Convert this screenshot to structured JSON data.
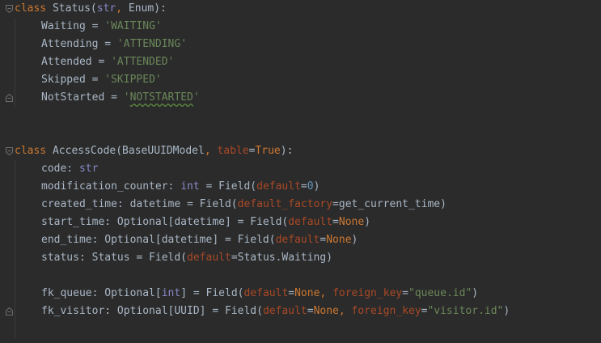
{
  "editor": {
    "lines": [
      {
        "name": "line-class-status",
        "tokens": [
          {
            "t": "class ",
            "c": "kw"
          },
          {
            "t": "Status(",
            "c": "plain"
          },
          {
            "t": "str",
            "c": "builtin"
          },
          {
            "t": ", ",
            "c": "kw"
          },
          {
            "t": "Enum):",
            "c": "plain"
          }
        ]
      },
      {
        "name": "line-waiting",
        "indent": 1,
        "tokens": [
          {
            "t": "Waiting = ",
            "c": "plain"
          },
          {
            "t": "'WAITING'",
            "c": "str"
          }
        ]
      },
      {
        "name": "line-attending",
        "indent": 1,
        "tokens": [
          {
            "t": "Attending = ",
            "c": "plain"
          },
          {
            "t": "'ATTENDING'",
            "c": "str"
          }
        ]
      },
      {
        "name": "line-attended",
        "indent": 1,
        "tokens": [
          {
            "t": "Attended = ",
            "c": "plain"
          },
          {
            "t": "'ATTENDED'",
            "c": "str"
          }
        ]
      },
      {
        "name": "line-skipped",
        "indent": 1,
        "tokens": [
          {
            "t": "Skipped = ",
            "c": "plain"
          },
          {
            "t": "'SKIPPED'",
            "c": "str"
          }
        ]
      },
      {
        "name": "line-notstarted",
        "indent": 1,
        "tokens": [
          {
            "t": "NotStarted = ",
            "c": "plain"
          },
          {
            "t": "'",
            "c": "str"
          },
          {
            "t": "NOTSTARTED",
            "c": "str squiggle"
          },
          {
            "t": "'",
            "c": "str"
          }
        ]
      },
      {
        "name": "line-blank-1",
        "tokens": []
      },
      {
        "name": "line-blank-2",
        "tokens": []
      },
      {
        "name": "line-class-accesscode",
        "tokens": [
          {
            "t": "class ",
            "c": "kw"
          },
          {
            "t": "AccessCode(BaseUUIDModel",
            "c": "plain"
          },
          {
            "t": ", ",
            "c": "kw"
          },
          {
            "t": "table",
            "c": "param"
          },
          {
            "t": "=",
            "c": "plain"
          },
          {
            "t": "True",
            "c": "kw"
          },
          {
            "t": "):",
            "c": "plain"
          }
        ]
      },
      {
        "name": "line-code",
        "indent": 1,
        "tokens": [
          {
            "t": "code: ",
            "c": "plain"
          },
          {
            "t": "str",
            "c": "builtin"
          }
        ]
      },
      {
        "name": "line-modification-counter",
        "indent": 1,
        "tokens": [
          {
            "t": "modification_counter: ",
            "c": "plain"
          },
          {
            "t": "int",
            "c": "builtin"
          },
          {
            "t": " = Field(",
            "c": "plain"
          },
          {
            "t": "default",
            "c": "param"
          },
          {
            "t": "=",
            "c": "plain"
          },
          {
            "t": "0",
            "c": "num"
          },
          {
            "t": ")",
            "c": "plain"
          }
        ]
      },
      {
        "name": "line-created-time",
        "indent": 1,
        "tokens": [
          {
            "t": "created_time: datetime = Field(",
            "c": "plain"
          },
          {
            "t": "default_factory",
            "c": "param"
          },
          {
            "t": "=get_current_time)",
            "c": "plain"
          }
        ]
      },
      {
        "name": "line-start-time",
        "indent": 1,
        "tokens": [
          {
            "t": "start_time: Optional[datetime] = Field(",
            "c": "plain"
          },
          {
            "t": "default",
            "c": "param"
          },
          {
            "t": "=",
            "c": "plain"
          },
          {
            "t": "None",
            "c": "kw"
          },
          {
            "t": ")",
            "c": "plain"
          }
        ]
      },
      {
        "name": "line-end-time",
        "indent": 1,
        "tokens": [
          {
            "t": "end_time: Optional[datetime] = Field(",
            "c": "plain"
          },
          {
            "t": "default",
            "c": "param"
          },
          {
            "t": "=",
            "c": "plain"
          },
          {
            "t": "None",
            "c": "kw"
          },
          {
            "t": ")",
            "c": "plain"
          }
        ]
      },
      {
        "name": "line-status",
        "indent": 1,
        "tokens": [
          {
            "t": "status: Status = Field(",
            "c": "plain"
          },
          {
            "t": "default",
            "c": "param"
          },
          {
            "t": "=Status.Waiting)",
            "c": "plain"
          }
        ]
      },
      {
        "name": "line-blank-3",
        "indent": 1,
        "tokens": []
      },
      {
        "name": "line-fk-queue",
        "indent": 1,
        "tokens": [
          {
            "t": "fk_queue: Optional[",
            "c": "plain"
          },
          {
            "t": "int",
            "c": "builtin"
          },
          {
            "t": "] = Field(",
            "c": "plain"
          },
          {
            "t": "default",
            "c": "param"
          },
          {
            "t": "=",
            "c": "plain"
          },
          {
            "t": "None",
            "c": "kw"
          },
          {
            "t": ", ",
            "c": "kw"
          },
          {
            "t": "foreign_key",
            "c": "param"
          },
          {
            "t": "=",
            "c": "plain"
          },
          {
            "t": "\"queue.id\"",
            "c": "str"
          },
          {
            "t": ")",
            "c": "plain"
          }
        ]
      },
      {
        "name": "line-fk-visitor",
        "indent": 1,
        "tokens": [
          {
            "t": "fk_visitor: Optional[UUID] = Field(",
            "c": "plain"
          },
          {
            "t": "default",
            "c": "param"
          },
          {
            "t": "=",
            "c": "plain"
          },
          {
            "t": "None",
            "c": "kw"
          },
          {
            "t": ", ",
            "c": "kw"
          },
          {
            "t": "foreign_key",
            "c": "param"
          },
          {
            "t": "=",
            "c": "plain"
          },
          {
            "t": "\"visitor.id\"",
            "c": "str"
          },
          {
            "t": ")",
            "c": "plain"
          }
        ]
      },
      {
        "name": "line-blank-4",
        "indent": 1,
        "tokens": []
      }
    ],
    "folds": [
      {
        "line": 0,
        "kind": "open"
      },
      {
        "line": 5,
        "kind": "close"
      },
      {
        "line": 8,
        "kind": "open"
      },
      {
        "line": 17,
        "kind": "close"
      }
    ]
  },
  "colors": {
    "background": "#2b2b2b",
    "keyword": "#cc7832",
    "builtin": "#8888c6",
    "string": "#6a8759",
    "parameter": "#aa4926",
    "number": "#6897bb",
    "text": "#a9b7c6"
  }
}
